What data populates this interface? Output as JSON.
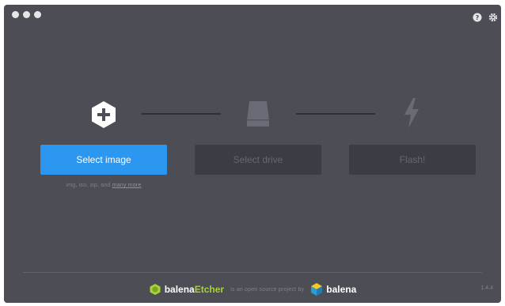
{
  "window": {
    "traffic_lights": [
      "close",
      "minimize",
      "maximize"
    ],
    "top_icons": [
      "help-icon",
      "settings-icon"
    ]
  },
  "steps": [
    {
      "icon": "plus-hexagon-icon",
      "button_label": "Select image",
      "state": "active"
    },
    {
      "icon": "drive-icon",
      "button_label": "Select drive",
      "state": "disabled"
    },
    {
      "icon": "lightning-icon",
      "button_label": "Flash!",
      "state": "disabled"
    }
  ],
  "hint": {
    "extensions": "img, iso, zip, and",
    "more_link": "many more"
  },
  "footer": {
    "brand_prefix": "balena",
    "brand_product": "Etcher",
    "tagline": "is an open source project by",
    "org_name": "balena",
    "version": "1.4.4"
  },
  "colors": {
    "background": "#4c4d55",
    "primary": "#2c97f1",
    "disabled_button": "#3b3c44",
    "etcher_green": "#a6d23a"
  }
}
